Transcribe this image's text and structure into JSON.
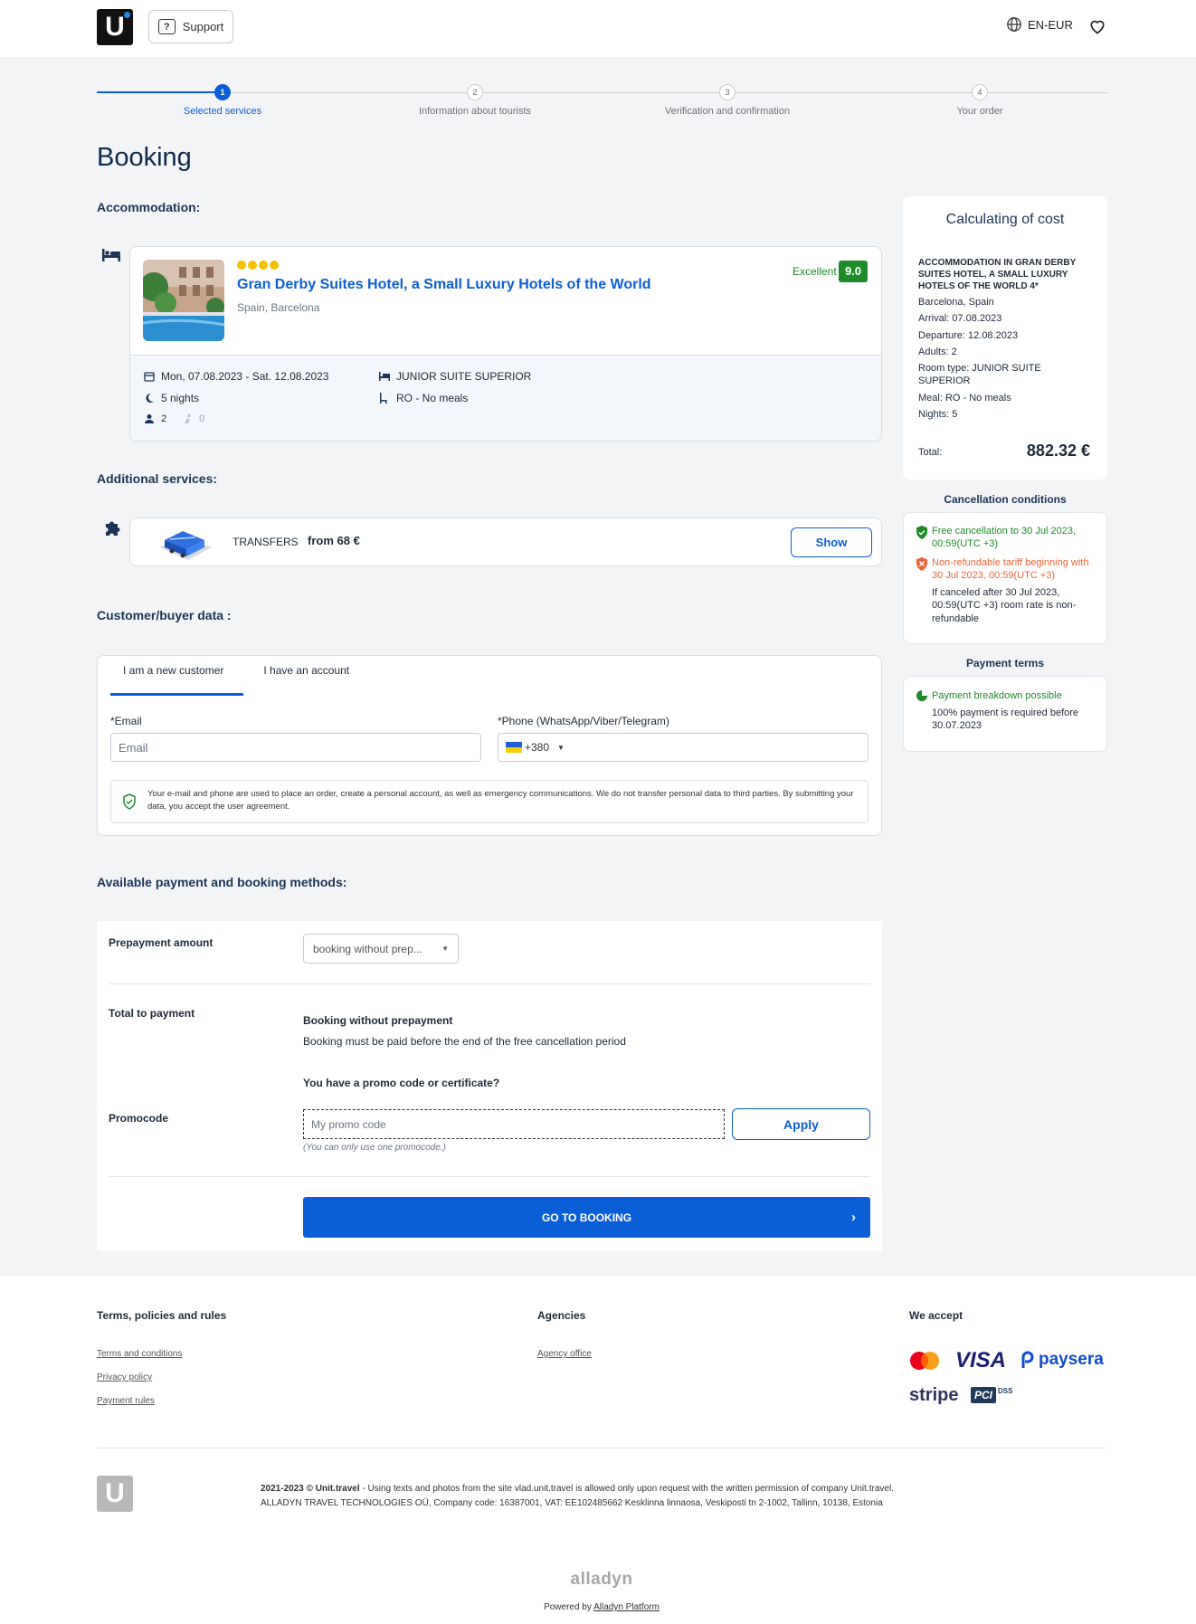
{
  "header": {
    "logo_letter": "U",
    "support_label": "Support",
    "support_icon_char": "?",
    "lang_label": "EN-EUR"
  },
  "steps": [
    {
      "num": "1",
      "label": "Selected services"
    },
    {
      "num": "2",
      "label": "Information about tourists"
    },
    {
      "num": "3",
      "label": "Verification and confirmation"
    },
    {
      "num": "4",
      "label": "Your order"
    }
  ],
  "page_title": "Booking",
  "accommodation": {
    "section_title": "Accommodation:",
    "hotel_name": "Gran Derby Suites Hotel, a Small Luxury Hotels of the World",
    "location": "Spain, Barcelona",
    "stars": 4,
    "rating_word": "Excellent",
    "rating": "9.0",
    "dates": "Mon, 07.08.2023 - Sat. 12.08.2023",
    "nights": "5 nights",
    "adults": "2",
    "children": "0",
    "room_type": "JUNIOR SUITE SUPERIOR",
    "meal": "RO - No meals"
  },
  "additional": {
    "section_title": "Additional services:",
    "transfers_label": "TRANSFERS",
    "transfers_price": "from 68 €",
    "show_label": "Show"
  },
  "customer": {
    "section_title": "Customer/buyer data :",
    "tab_new": "I am a new customer",
    "tab_account": "I have an account",
    "email_label": "*Email",
    "email_placeholder": "Email",
    "phone_label": "*Phone (WhatsApp/Viber/Telegram)",
    "phone_code": "+380",
    "notice": "Your e-mail and phone are used to place an order, create a personal account, as well as emergency communications. We do not transfer personal data to third parties. By submitting your data, you accept the user agreement."
  },
  "payment": {
    "section_title": "Available payment and booking methods:",
    "prepayment_label": "Prepayment amount",
    "prepayment_value": "booking without prep...",
    "total_label": "Total to payment",
    "booking_title": "Booking without prepayment",
    "booking_desc": "Booking must be paid before the end of the free cancellation period",
    "promo_question": "You have a promo code or certificate?",
    "promo_label": "Promocode",
    "promo_placeholder": "My promo code",
    "promo_hint": "(You can only use one promocode.)",
    "apply_label": "Apply",
    "go_label": "GO TO BOOKING"
  },
  "cost": {
    "title": "Calculating of cost",
    "heading": "ACCOMMODATION IN GRAN DERBY SUITES HOTEL, A SMALL LUXURY HOTELS OF THE WORLD 4*",
    "lines": [
      "Barcelona, Spain",
      "Arrival: 07.08.2023",
      "Departure: 12.08.2023",
      "Adults: 2",
      "Room type: JUNIOR SUITE SUPERIOR",
      "Meal: RO - No meals",
      "Nights: 5"
    ],
    "total_label": "Total:",
    "total_value": "882.32 €"
  },
  "cancellation": {
    "title": "Cancellation conditions",
    "free": "Free cancellation to 30 Jul 2023, 00:59(UTC +3)",
    "nonref": "Non-refundable tariff beginning with 30 Jul 2023, 00:59(UTC +3)",
    "note": "If canceled after 30 Jul 2023, 00:59(UTC +3) room rate is non-refundable"
  },
  "payment_terms": {
    "title": "Payment terms",
    "breakdown": "Payment breakdown possible",
    "required": "100% payment is required before 30.07.2023"
  },
  "footer": {
    "terms_title": "Terms, policies and rules",
    "terms_links": [
      "Terms and conditions",
      "Privacy policy",
      "Payment rules"
    ],
    "agencies_title": "Agencies",
    "agency_link": "Agency office",
    "accept_title": "We accept",
    "visa": "VISA",
    "paysera": "paysera",
    "stripe": "stripe",
    "pci": "PCI",
    "dss": "DSS",
    "copyright_bold": "2021-2023 © Unit.travel",
    "copyright_rest": " - Using texts and photos from the site vlad.unit.travel is allowed only upon request with the written permission of company Unit.travel.",
    "company": "ALLADYN TRAVEL TECHNOLOGIES OÜ, Company code: 16387001, VAT: EE102485662 Kesklinna linnaosa, Veskiposti tn 2-1002, Tallinn, 10138, Estonia",
    "alladyn": "alladyn",
    "powered_by": "Powered by ",
    "powered_link": "Alladyn Platform"
  }
}
